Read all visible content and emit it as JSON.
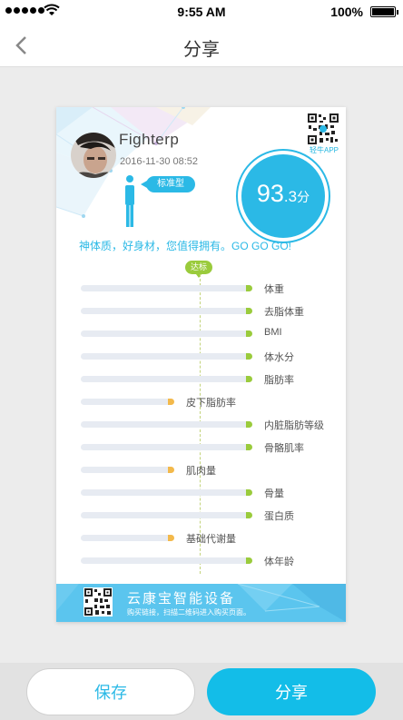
{
  "status_bar": {
    "time": "9:55 AM",
    "battery": "100%"
  },
  "nav": {
    "title": "分享",
    "back_icon": "chevron-left-icon"
  },
  "card": {
    "username": "Fighterp",
    "datetime": "2016-11-30  08:52",
    "app_qr_label": "轻牛APP",
    "body_type": "标准型",
    "score": {
      "main": "93",
      "decimal": ".3",
      "unit": "分"
    },
    "slogan": "神体质，好身材，您值得拥有。GO GO GO!",
    "standard_label": "达标",
    "colors": {
      "accent": "#2bb9e6",
      "standard": "#9acb3c",
      "low": "#f3b94b"
    },
    "metrics": [
      {
        "label": "体重",
        "level": "standard"
      },
      {
        "label": "去脂体重",
        "level": "standard"
      },
      {
        "label": "BMI",
        "level": "standard"
      },
      {
        "label": "体水分",
        "level": "standard"
      },
      {
        "label": "脂肪率",
        "level": "standard"
      },
      {
        "label": "皮下脂肪率",
        "level": "low"
      },
      {
        "label": "内脏脂肪等级",
        "level": "standard"
      },
      {
        "label": "骨骼肌率",
        "level": "standard"
      },
      {
        "label": "肌肉量",
        "level": "low"
      },
      {
        "label": "骨量",
        "level": "standard"
      },
      {
        "label": "蛋白质",
        "level": "standard"
      },
      {
        "label": "基础代谢量",
        "level": "low"
      },
      {
        "label": "体年龄",
        "level": "standard"
      }
    ],
    "footer": {
      "title": "云康宝智能设备",
      "subtitle": "购买链接，扫描二维码进入购买页面。"
    }
  },
  "actions": {
    "save_label": "保存",
    "share_label": "分享"
  }
}
